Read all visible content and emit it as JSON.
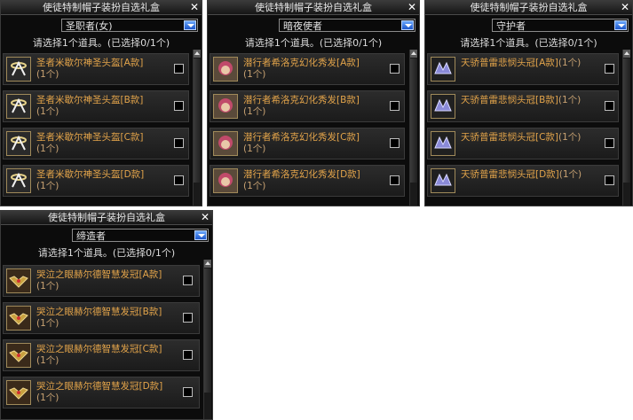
{
  "colors": {
    "item_text": "#e3a44a",
    "panel_bg": "#0c0c0c",
    "dropdown_button": "#2b6be0"
  },
  "panels": [
    {
      "title": "使徒特制帽子装扮自选礼盒",
      "close_glyph": "✕",
      "dropdown_value": "圣职者(女)",
      "instruction": "请选择1个道具。(已选择0/1个)",
      "items": [
        {
          "name": "圣者米歇尔神圣头盔[A款]",
          "count": "(1个)",
          "icon": "halo-helmet-icon",
          "checked": false
        },
        {
          "name": "圣者米歇尔神圣头盔[B款]",
          "count": "(1个)",
          "icon": "halo-helmet-icon",
          "checked": false
        },
        {
          "name": "圣者米歇尔神圣头盔[C款]",
          "count": "(1个)",
          "icon": "halo-helmet-icon",
          "checked": false
        },
        {
          "name": "圣者米歇尔神圣头盔[D款]",
          "count": "(1个)",
          "icon": "halo-helmet-icon",
          "checked": false
        }
      ]
    },
    {
      "title": "使徒特制帽子装扮自选礼盒",
      "close_glyph": "✕",
      "dropdown_value": "暗夜使者",
      "instruction": "请选择1个道具。(已选择0/1个)",
      "items": [
        {
          "name": "潜行者希洛克幻化秀发[A款]",
          "count": "(1个)",
          "icon": "hair-icon",
          "checked": false
        },
        {
          "name": "潜行者希洛克幻化秀发[B款]",
          "count": "(1个)",
          "icon": "hair-icon",
          "checked": false
        },
        {
          "name": "潜行者希洛克幻化秀发[C款]",
          "count": "(1个)",
          "icon": "hair-icon",
          "checked": false
        },
        {
          "name": "潜行者希洛克幻化秀发[D款]",
          "count": "(1个)",
          "icon": "hair-icon",
          "checked": false
        }
      ]
    },
    {
      "title": "使徒特制帽子装扮自选礼盒",
      "close_glyph": "✕",
      "dropdown_value": "守护者",
      "instruction": "请选择1个道具。(已选择0/1个)",
      "items": [
        {
          "name": "天骄普雷悲悯头冠[A款]",
          "count": "(1个)",
          "icon": "winged-crown-icon",
          "checked": false
        },
        {
          "name": "天骄普雷悲悯头冠[B款]",
          "count": "(1个)",
          "icon": "winged-crown-icon",
          "checked": false
        },
        {
          "name": "天骄普雷悲悯头冠[C款]",
          "count": "(1个)",
          "icon": "winged-crown-icon",
          "checked": false
        },
        {
          "name": "天骄普雷悲悯头冠[D款]",
          "count": "(1个)",
          "icon": "winged-crown-icon",
          "checked": false
        }
      ]
    },
    {
      "title": "使徒特制帽子装扮自选礼盒",
      "close_glyph": "✕",
      "dropdown_value": "缔造者",
      "instruction": "请选择1个道具。(已选择0/1个)",
      "items": [
        {
          "name": "哭泣之眼赫尔德智慧发冠[A款]",
          "count": "(1个)",
          "icon": "eye-crown-icon",
          "checked": false
        },
        {
          "name": "哭泣之眼赫尔德智慧发冠[B款]",
          "count": "(1个)",
          "icon": "eye-crown-icon",
          "checked": false
        },
        {
          "name": "哭泣之眼赫尔德智慧发冠[C款]",
          "count": "(1个)",
          "icon": "eye-crown-icon",
          "checked": false
        },
        {
          "name": "哭泣之眼赫尔德智慧发冠[D款]",
          "count": "(1个)",
          "icon": "eye-crown-icon",
          "checked": false
        }
      ]
    }
  ]
}
